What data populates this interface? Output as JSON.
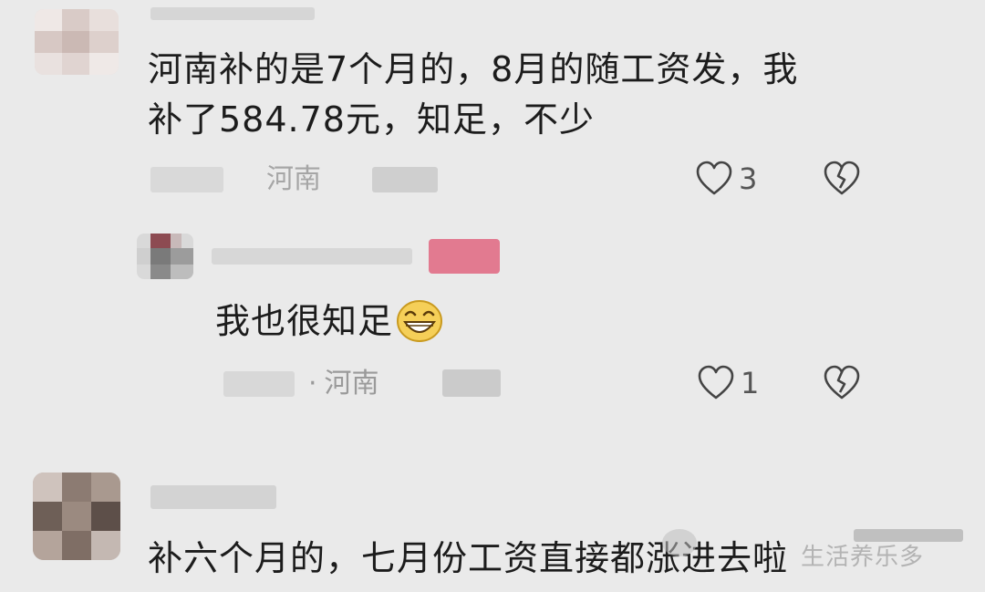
{
  "comments": [
    {
      "text_line1": "河南补的是7个月的，8月的随工资发，我",
      "text_line2": "补了584.78元，知足，不少",
      "location": "河南",
      "likes": "3"
    },
    {
      "text": "我也很知足",
      "emoji": "grinning-face",
      "location_prefix": "·",
      "location": "河南",
      "likes": "1"
    },
    {
      "text": "补六个月的，七月份工资直接都涨进去啦"
    }
  ],
  "watermark": "生活养乐多"
}
